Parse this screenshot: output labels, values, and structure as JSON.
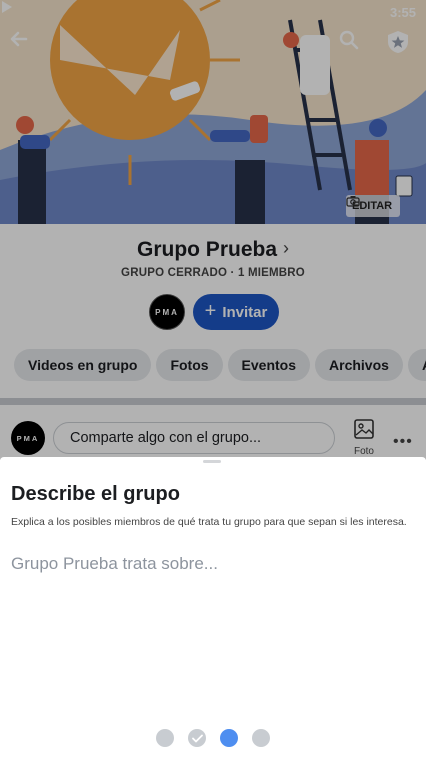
{
  "status_bar": {
    "time": "3:55"
  },
  "cover": {
    "edit_label": "EDITAR"
  },
  "group": {
    "name": "Grupo Prueba",
    "meta": "GRUPO CERRADO · 1 MIEMBRO",
    "avatar_text": "PMA",
    "invite_label": "Invitar"
  },
  "tabs": [
    "Videos en grupo",
    "Fotos",
    "Eventos",
    "Archivos",
    "Álb"
  ],
  "composer": {
    "avatar_text": "PMA",
    "placeholder": "Comparte algo con el grupo...",
    "photo_label": "Foto"
  },
  "sheet": {
    "title": "Describe el grupo",
    "description": "Explica a los posibles miembros de qué trata tu grupo para que sepan si les interesa.",
    "input_placeholder": "Grupo Prueba trata sobre...",
    "input_value": ""
  },
  "stepper": {
    "total_steps": 4,
    "current_step": 3,
    "completed_steps": [
      2
    ]
  },
  "colors": {
    "primary": "#1e57c4",
    "step_active": "#4e8ef0",
    "step_inactive": "#c8ccd1"
  },
  "icons": {
    "back": "arrow-left-icon",
    "search": "search-icon",
    "shield": "shield-star-icon",
    "camera": "camera-icon",
    "photo": "photo-icon",
    "more": "more-horizontal-icon",
    "chevron": "chevron-right-icon"
  }
}
